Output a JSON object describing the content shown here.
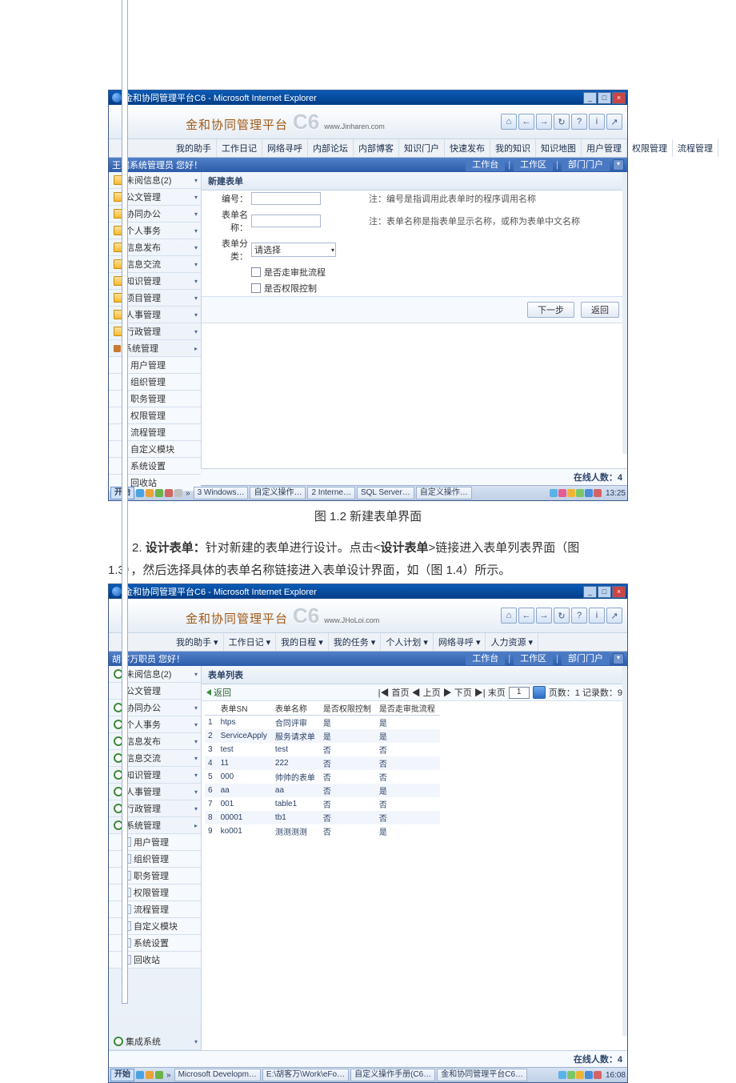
{
  "shot1": {
    "titlebar": "金和协同管理平台C6 - Microsoft Internet Explorer",
    "logo_text": "金和协同管理平台",
    "logo_c6": "C6",
    "logo_url": "www.Jinharen.com",
    "banner_icons": [
      "⌂",
      "←",
      "→",
      "↻",
      "?",
      "i",
      "↗"
    ],
    "top_tabs": [
      "我的助手",
      "工作日记",
      "网络寻呼",
      "内部论坛",
      "内部博客",
      "知识门户",
      "快速发布",
      "我的知识",
      "知识地图",
      "用户管理",
      "权限管理",
      "流程管理"
    ],
    "greeting": "王瑞系统管理员 您好！",
    "right_tabs": [
      "工作台",
      "工作区",
      "部门门户"
    ],
    "sidebar": {
      "top": [
        "未阅信息(2)",
        "公文管理",
        "协同办公",
        "个人事务",
        "信息发布",
        "信息交流",
        "知识管理",
        "项目管理",
        "人事管理",
        "行政管理"
      ],
      "sysmgmt": "系统管理",
      "sub": [
        "用户管理",
        "组织管理",
        "职务管理",
        "权限管理",
        "流程管理",
        "自定义模块",
        "系统设置",
        "回收站"
      ]
    },
    "main": {
      "panel_title": "新建表单",
      "label_code": "编号：",
      "label_name": "表单名称：",
      "label_category": "表单分类：",
      "select_placeholder": "请选择",
      "note_code": "注：编号是指调用此表单时的程序调用名称",
      "note_name": "注：表单名称是指表单显示名称，或称为表单中文名称",
      "cb1": "是否走审批流程",
      "cb2": "是否权限控制",
      "btn_next": "下一步",
      "btn_back": "返回"
    },
    "footer_online": "在线人数：4",
    "taskbar": {
      "start": "开始",
      "items": [
        "3 Windows…",
        "自定义操作…",
        "2 Interne…",
        "SQL Server…",
        "自定义操作…"
      ],
      "clock": "13:25"
    }
  },
  "caption1": "图 1.2  新建表单界面",
  "para1_lead": "2. ",
  "para1_bold1": "设计表单：",
  "para1_mid": "针对新建的表单进行设计。点击<",
  "para1_bold2": "设计表单",
  "para1_tail": ">链接进入表单列表界面（图 ",
  "para2": "1.3），然后选择具体的表单名称链接进入表单设计界面，如（图 1.4）所示。",
  "shot2": {
    "titlebar": "金和协同管理平台C6 - Microsoft Internet Explorer",
    "logo_text": "金和协同管理平台",
    "logo_c6": "C6",
    "logo_url": "www.JHoLoi.com",
    "banner_icons": [
      "⌂",
      "←",
      "→",
      "↻",
      "?",
      "i",
      "↗"
    ],
    "top_tabs": [
      "我的助手 ▾",
      "工作日记 ▾",
      "我的日程 ▾",
      "我的任务 ▾",
      "个人计划 ▾",
      "网络寻呼 ▾",
      "人力资源 ▾"
    ],
    "greeting": "胡客万职员 您好！",
    "right_tabs": [
      "工作台",
      "工作区",
      "部门门户"
    ],
    "sidebar": {
      "top": [
        "未阅信息(2)",
        "公文管理",
        "协同办公",
        "个人事务",
        "信息发布",
        "信息交流",
        "知识管理",
        "人事管理",
        "行政管理"
      ],
      "sysmgmt": "系统管理",
      "sub": [
        "用户管理",
        "组织管理",
        "职务管理",
        "权限管理",
        "流程管理",
        "自定义模块",
        "系统设置",
        "回收站"
      ],
      "integrate": "集成系统"
    },
    "main": {
      "panel_title": "表单列表",
      "back": "返回",
      "pager_left": "|◀ 首页 ◀ 上页 ▶ 下页 ▶| 末页",
      "pager_page_value": "1",
      "pager_right": "页数：1 记录数：9",
      "headers": [
        "",
        "表单SN",
        "表单名称",
        "是否权限控制",
        "是否走审批流程"
      ],
      "rows": [
        [
          "1",
          "htps",
          "合同评审",
          "是",
          "是"
        ],
        [
          "2",
          "ServiceApply",
          "服务请求单",
          "是",
          "是"
        ],
        [
          "3",
          "test",
          "test",
          "否",
          "否"
        ],
        [
          "4",
          "11",
          "222",
          "否",
          "否"
        ],
        [
          "5",
          "000",
          "帅帅的表单",
          "否",
          "否"
        ],
        [
          "6",
          "aa",
          "aa",
          "否",
          "是"
        ],
        [
          "7",
          "001",
          "table1",
          "否",
          "否"
        ],
        [
          "8",
          "00001",
          "tb1",
          "否",
          "否"
        ],
        [
          "9",
          "ko001",
          "测测测测",
          "否",
          "是"
        ]
      ]
    },
    "footer_online": "在线人数：4",
    "taskbar": {
      "start": "开始",
      "items": [
        "Microsoft Developm…",
        "E:\\胡客万\\Work\\eFo…",
        "自定义操作手册(C6…",
        "金和协同管理平台C6…"
      ],
      "clock": "16:08"
    }
  }
}
